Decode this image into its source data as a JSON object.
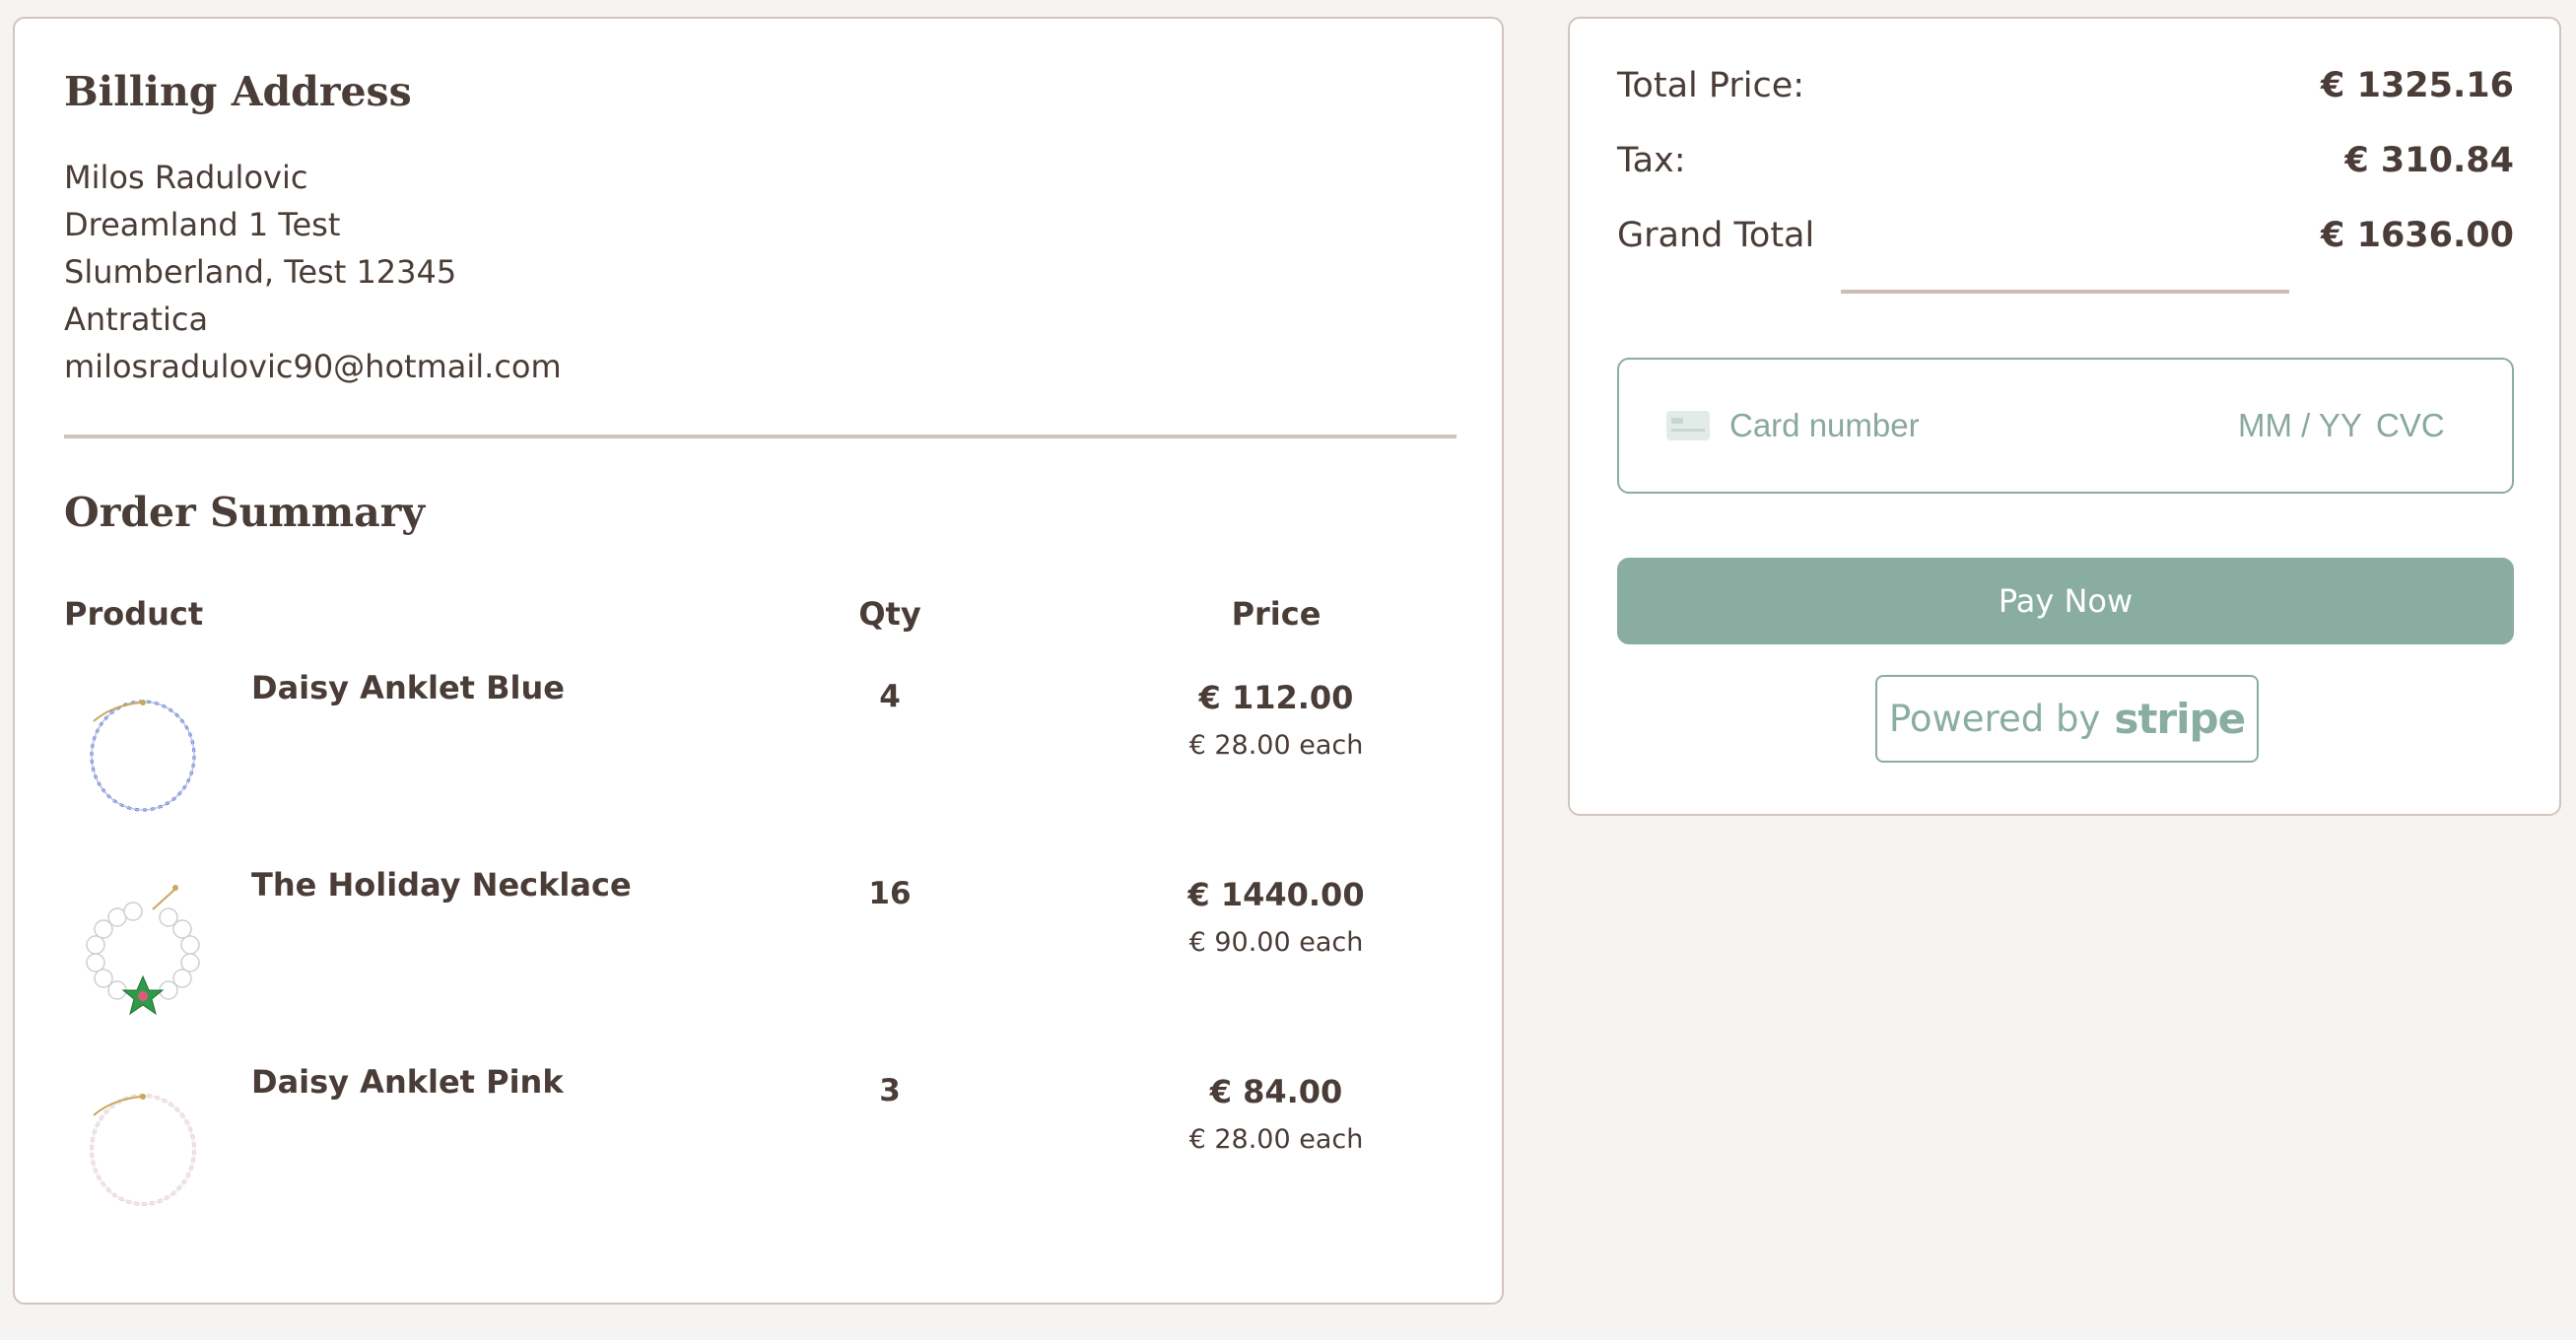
{
  "billing": {
    "title": "Billing Address",
    "name": "Milos Radulovic",
    "street": "Dreamland 1 Test",
    "city_line": "Slumberland, Test 12345",
    "country": "Antratica",
    "email": "milosradulovic90@hotmail.com"
  },
  "order": {
    "title": "Order Summary",
    "headers": {
      "product": "Product",
      "qty": "Qty",
      "price": "Price"
    },
    "items": [
      {
        "name": "Daisy Anklet Blue",
        "qty": "4",
        "total": "€ 112.00",
        "each": "€ 28.00 each",
        "image": "blue-beaded-anklet"
      },
      {
        "name": "The Holiday Necklace",
        "qty": "16",
        "total": "€ 1440.00",
        "each": "€ 90.00 each",
        "image": "pearl-necklace-green-flower"
      },
      {
        "name": "Daisy Anklet Pink",
        "qty": "3",
        "total": "€ 84.00",
        "each": "€ 28.00 each",
        "image": "pink-beaded-anklet"
      }
    ]
  },
  "summary": {
    "total_price_label": "Total Price:",
    "total_price_value": "€ 1325.16",
    "tax_label": "Tax:",
    "tax_value": "€ 310.84",
    "grand_total_label": "Grand Total",
    "grand_total_value": "€ 1636.00"
  },
  "payment": {
    "card_icon": "credit-card-icon",
    "card_number_placeholder": "Card number",
    "expiry_placeholder": "MM / YY",
    "cvc_placeholder": "CVC",
    "pay_button_label": "Pay Now",
    "powered_by_label": "Powered by",
    "stripe_logo_text": "stripe"
  },
  "colors": {
    "accent": "#8aada2",
    "text": "#4a3c37",
    "border": "#d2c4bf",
    "background": "#f6f4f2"
  }
}
